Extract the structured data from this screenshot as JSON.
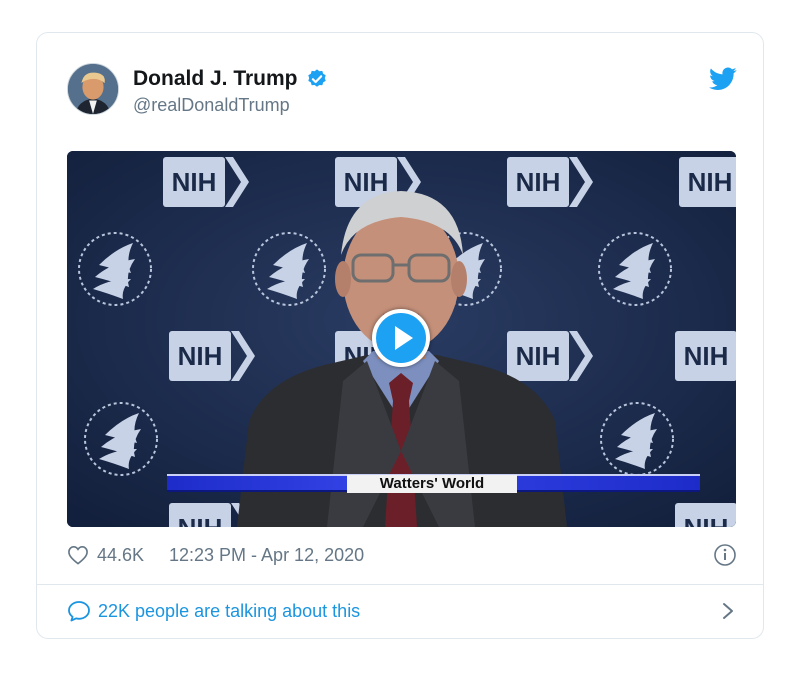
{
  "tweet": {
    "author": {
      "display_name": "Donald J. Trump",
      "handle": "@realDonaldTrump",
      "verified": true
    },
    "media": {
      "type": "video",
      "backdrop_logo_text": "NIH",
      "lower_third_text": "Watters' World"
    },
    "likes": "44.6K",
    "timestamp": "12:23 PM - Apr 12, 2020",
    "conversation_text": "22K people are talking about this"
  },
  "colors": {
    "twitter_blue": "#1da1f2",
    "link_blue": "#1b95e0",
    "muted_text": "#657786",
    "border": "#e1e8ed",
    "backdrop_navy": "#1b2a48"
  },
  "icons": [
    "verified-badge-icon",
    "twitter-bird-icon",
    "play-icon",
    "heart-icon",
    "info-icon",
    "speech-bubble-icon",
    "chevron-right-icon"
  ]
}
